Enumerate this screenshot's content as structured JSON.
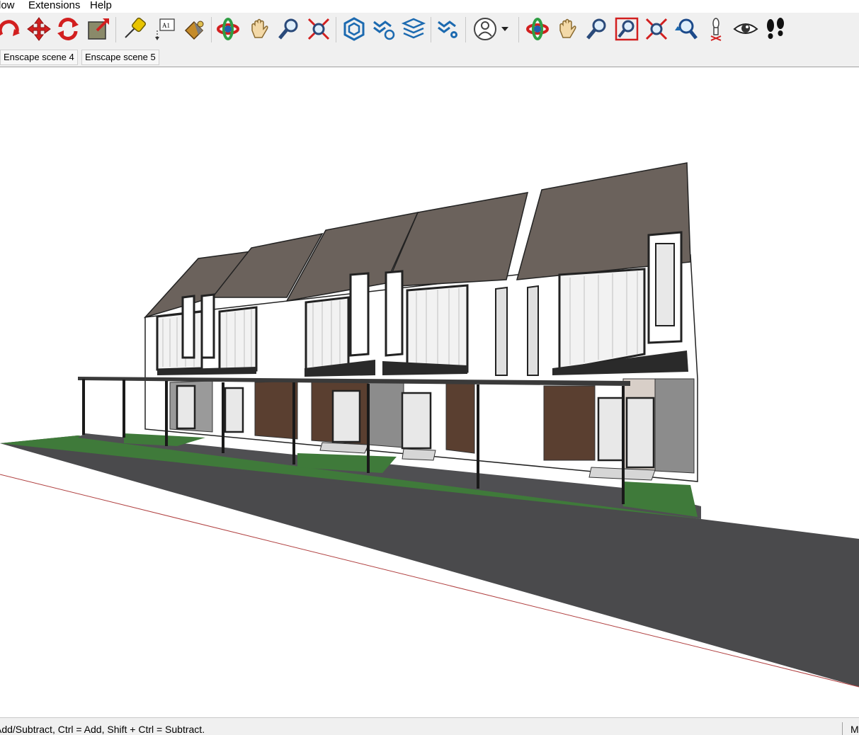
{
  "menu": {
    "items": [
      "low",
      "Extensions",
      "Help"
    ]
  },
  "toolbar": {
    "buttons": [
      "follow-me-icon",
      "move-icon",
      "rotate-icon",
      "scale-icon",
      "tape-measure-icon",
      "text-label-icon",
      "paint-bucket-icon",
      "orbit-icon",
      "pan-icon",
      "zoom-icon",
      "zoom-extents-icon",
      "tag-manager-icon",
      "tag-visibility-icon",
      "layer-stack-icon",
      "tag-settings-icon",
      "profile-icon",
      "orbit-icon",
      "pan-icon",
      "zoom-icon",
      "zoom-window-icon",
      "zoom-extents-icon",
      "previous-view-icon",
      "position-camera-icon",
      "look-around-icon",
      "walk-icon"
    ]
  },
  "scenes": {
    "tabs": [
      "Enscape scene 4",
      "Enscape scene 5"
    ]
  },
  "status": {
    "hint": "Add/Subtract, Ctrl = Add, Shift + Ctrl = Subtract.",
    "measurements": "M"
  },
  "colors": {
    "road": "#4a4a4c",
    "roof": "#6b625c",
    "wall": "#ffffff",
    "lawn": "#3f7a3a",
    "timber": "#5a3f30",
    "stone": "#8c8c8c",
    "trim": "#2a2a2a",
    "toolbar_bg": "#f0f0f0"
  }
}
